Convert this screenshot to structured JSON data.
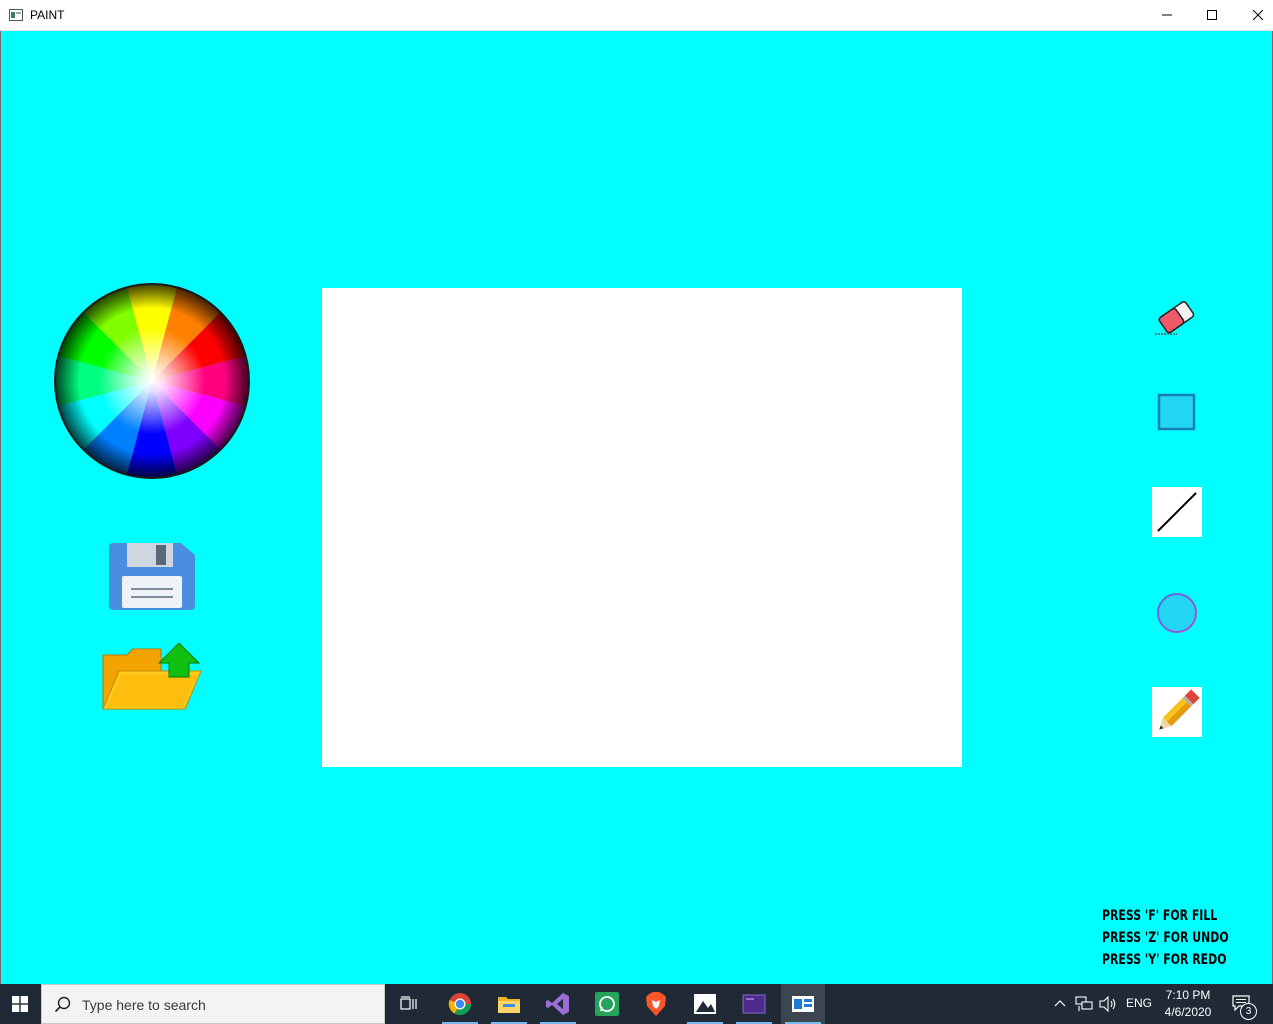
{
  "window": {
    "title": "PAINT",
    "controls": [
      "minimize",
      "maximize",
      "close"
    ]
  },
  "colors": {
    "background": "#00FFFF",
    "canvas": "#FFFFFF",
    "taskbar": "#1F2A36"
  },
  "left_tools": [
    "color-wheel",
    "save",
    "open"
  ],
  "right_tools": [
    "eraser",
    "rectangle",
    "line",
    "circle",
    "pencil"
  ],
  "hints": {
    "fill": "PRESS 'F' FOR FILL",
    "undo": "PRESS 'Z' FOR UNDO",
    "redo": "PRESS 'Y' FOR REDO"
  },
  "taskbar": {
    "search_placeholder": "Type here to search",
    "apps": [
      "task-view",
      "chrome",
      "file-explorer",
      "visual-studio",
      "whatsapp",
      "brave",
      "photos",
      "terminal",
      "paint-app"
    ],
    "language": "ENG",
    "time": "7:10 PM",
    "date": "4/6/2020",
    "notification_count": "3"
  }
}
